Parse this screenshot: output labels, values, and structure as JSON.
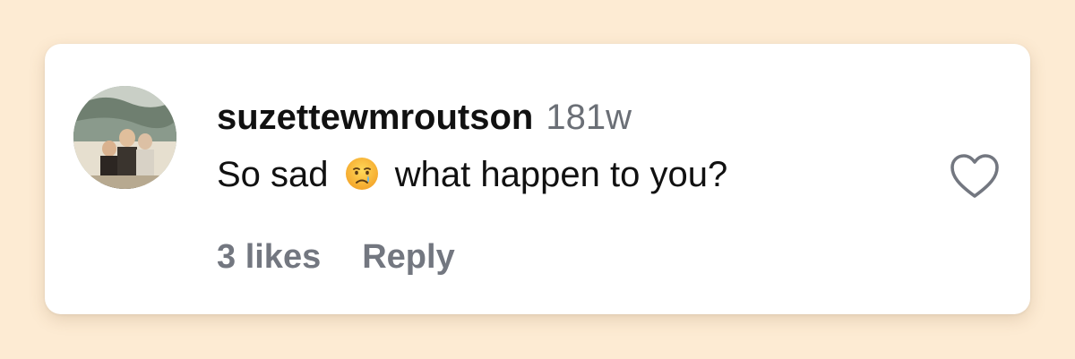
{
  "comment": {
    "username": "suzettewmroutson",
    "timestamp": "181w",
    "text_before_emoji": "So sad",
    "emoji": "crying-face",
    "text_after_emoji": "what happen to you?",
    "likes_label": "3 likes",
    "reply_label": "Reply",
    "like_icon": "heart-outline-icon"
  },
  "colors": {
    "page_background": "#fdebd3",
    "card_background": "#ffffff",
    "primary_text": "#111111",
    "secondary_text": "#737780"
  }
}
